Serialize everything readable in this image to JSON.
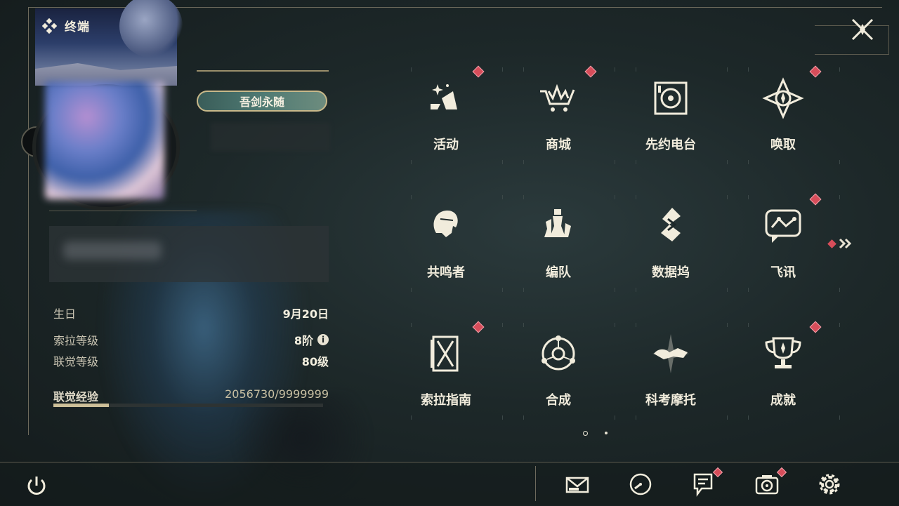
{
  "header": {
    "title": "终端",
    "close_icon": "close-x-icon"
  },
  "profile": {
    "title_badge": "吾剑永随",
    "stats": [
      {
        "label": "生日",
        "value": "9月20日"
      },
      {
        "label": "索拉等级",
        "value": "8阶"
      },
      {
        "label": "联觉等级",
        "value": "80级"
      },
      {
        "label": "联觉经验",
        "value": "2056730/9999999"
      }
    ],
    "exp_progress": 0.2057
  },
  "menu": [
    {
      "label": "活动",
      "icon": "event-icon",
      "badge": true
    },
    {
      "label": "商城",
      "icon": "shop-cart-icon",
      "badge": true
    },
    {
      "label": "先约电台",
      "icon": "radio-icon",
      "badge": false
    },
    {
      "label": "唤取",
      "icon": "convene-icon",
      "badge": true
    },
    {
      "label": "共鸣者",
      "icon": "resonator-icon",
      "badge": false
    },
    {
      "label": "编队",
      "icon": "team-chess-icon",
      "badge": false
    },
    {
      "label": "数据坞",
      "icon": "data-dock-icon",
      "badge": false
    },
    {
      "label": "飞讯",
      "icon": "message-chat-icon",
      "badge": true
    },
    {
      "label": "索拉指南",
      "icon": "guidebook-icon",
      "badge": true
    },
    {
      "label": "合成",
      "icon": "synthesis-icon",
      "badge": false
    },
    {
      "label": "科考摩托",
      "icon": "motorcycle-icon",
      "badge": false
    },
    {
      "label": "成就",
      "icon": "trophy-icon",
      "badge": true
    }
  ],
  "pager": {
    "pages": 2,
    "current": 1
  },
  "bottom": [
    {
      "icon": "mail-icon",
      "badge": false
    },
    {
      "icon": "clock-icon",
      "badge": false
    },
    {
      "icon": "notice-icon",
      "badge": true
    },
    {
      "icon": "camera-icon",
      "badge": true
    },
    {
      "icon": "settings-gear-icon",
      "badge": false
    }
  ],
  "colors": {
    "accent_gold": "#cdbf98",
    "badge_red": "#d74d5a",
    "text": "#f1ecdc"
  }
}
